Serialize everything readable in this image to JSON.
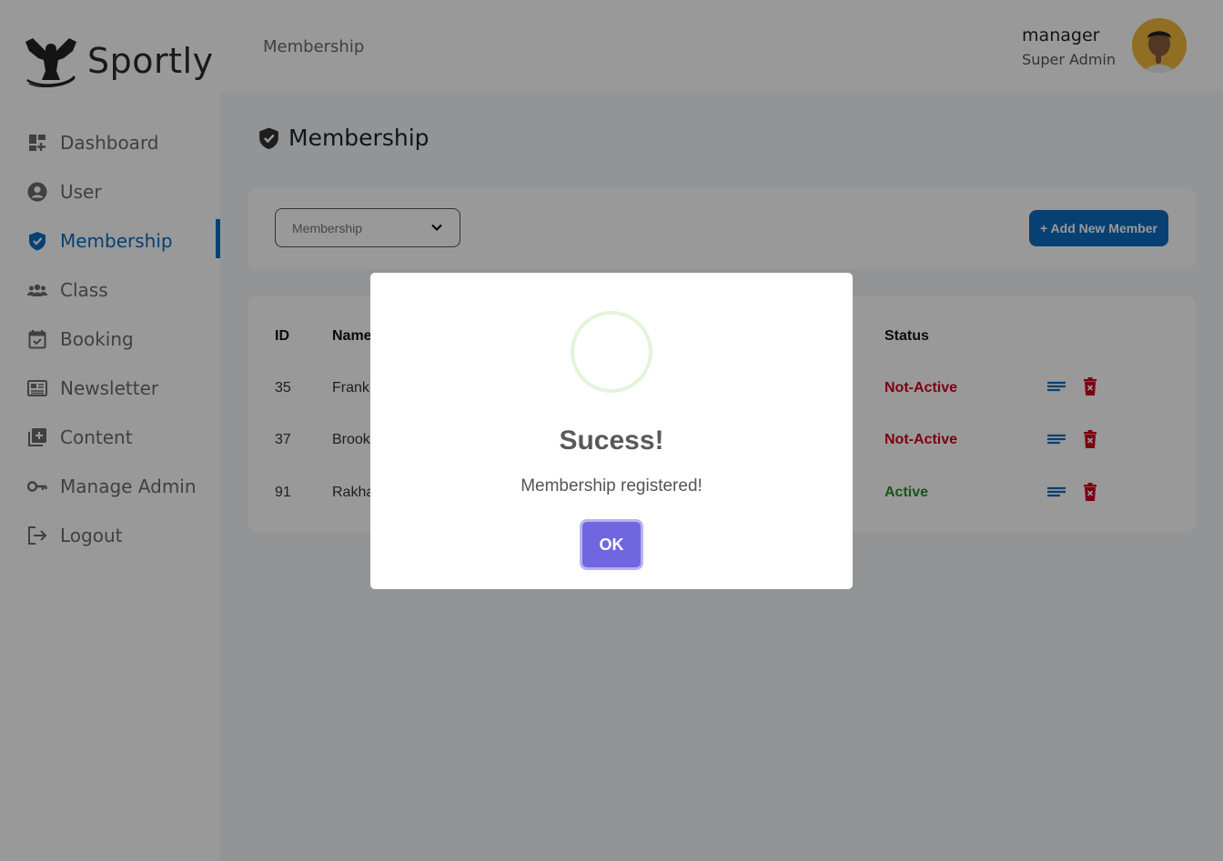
{
  "app": {
    "name": "Sportly"
  },
  "header": {
    "breadcrumb": "Membership",
    "user_name": "manager",
    "user_role": "Super Admin"
  },
  "sidebar": {
    "items": [
      {
        "label": "Dashboard",
        "icon": "dashboard-icon"
      },
      {
        "label": "User",
        "icon": "user-circle-icon"
      },
      {
        "label": "Membership",
        "icon": "shield-check-icon",
        "active": true
      },
      {
        "label": "Class",
        "icon": "group-icon"
      },
      {
        "label": "Booking",
        "icon": "calendar-check-icon"
      },
      {
        "label": "Newsletter",
        "icon": "newspaper-icon"
      },
      {
        "label": "Content",
        "icon": "add-library-icon"
      },
      {
        "label": "Manage Admin",
        "icon": "key-icon"
      },
      {
        "label": "Logout",
        "icon": "logout-icon"
      }
    ]
  },
  "main": {
    "title": "Membership",
    "filter": {
      "selected": "Membership"
    },
    "add_button": "+ Add New Member",
    "table": {
      "headers": {
        "id": "ID",
        "name": "Name",
        "status": "Status"
      },
      "rows": [
        {
          "id": "35",
          "name": "Frank",
          "status": "Not-Active"
        },
        {
          "id": "37",
          "name": "Brook",
          "status": "Not-Active"
        },
        {
          "id": "91",
          "name": "Rakha",
          "status": "Active"
        }
      ]
    }
  },
  "modal": {
    "title": "Sucess!",
    "message": "Membership registered!",
    "ok_label": "OK"
  },
  "colors": {
    "primary": "#0d6bbf",
    "inactive": "#d0021b",
    "active": "#2e8b2e",
    "confirm": "#7066e0"
  }
}
